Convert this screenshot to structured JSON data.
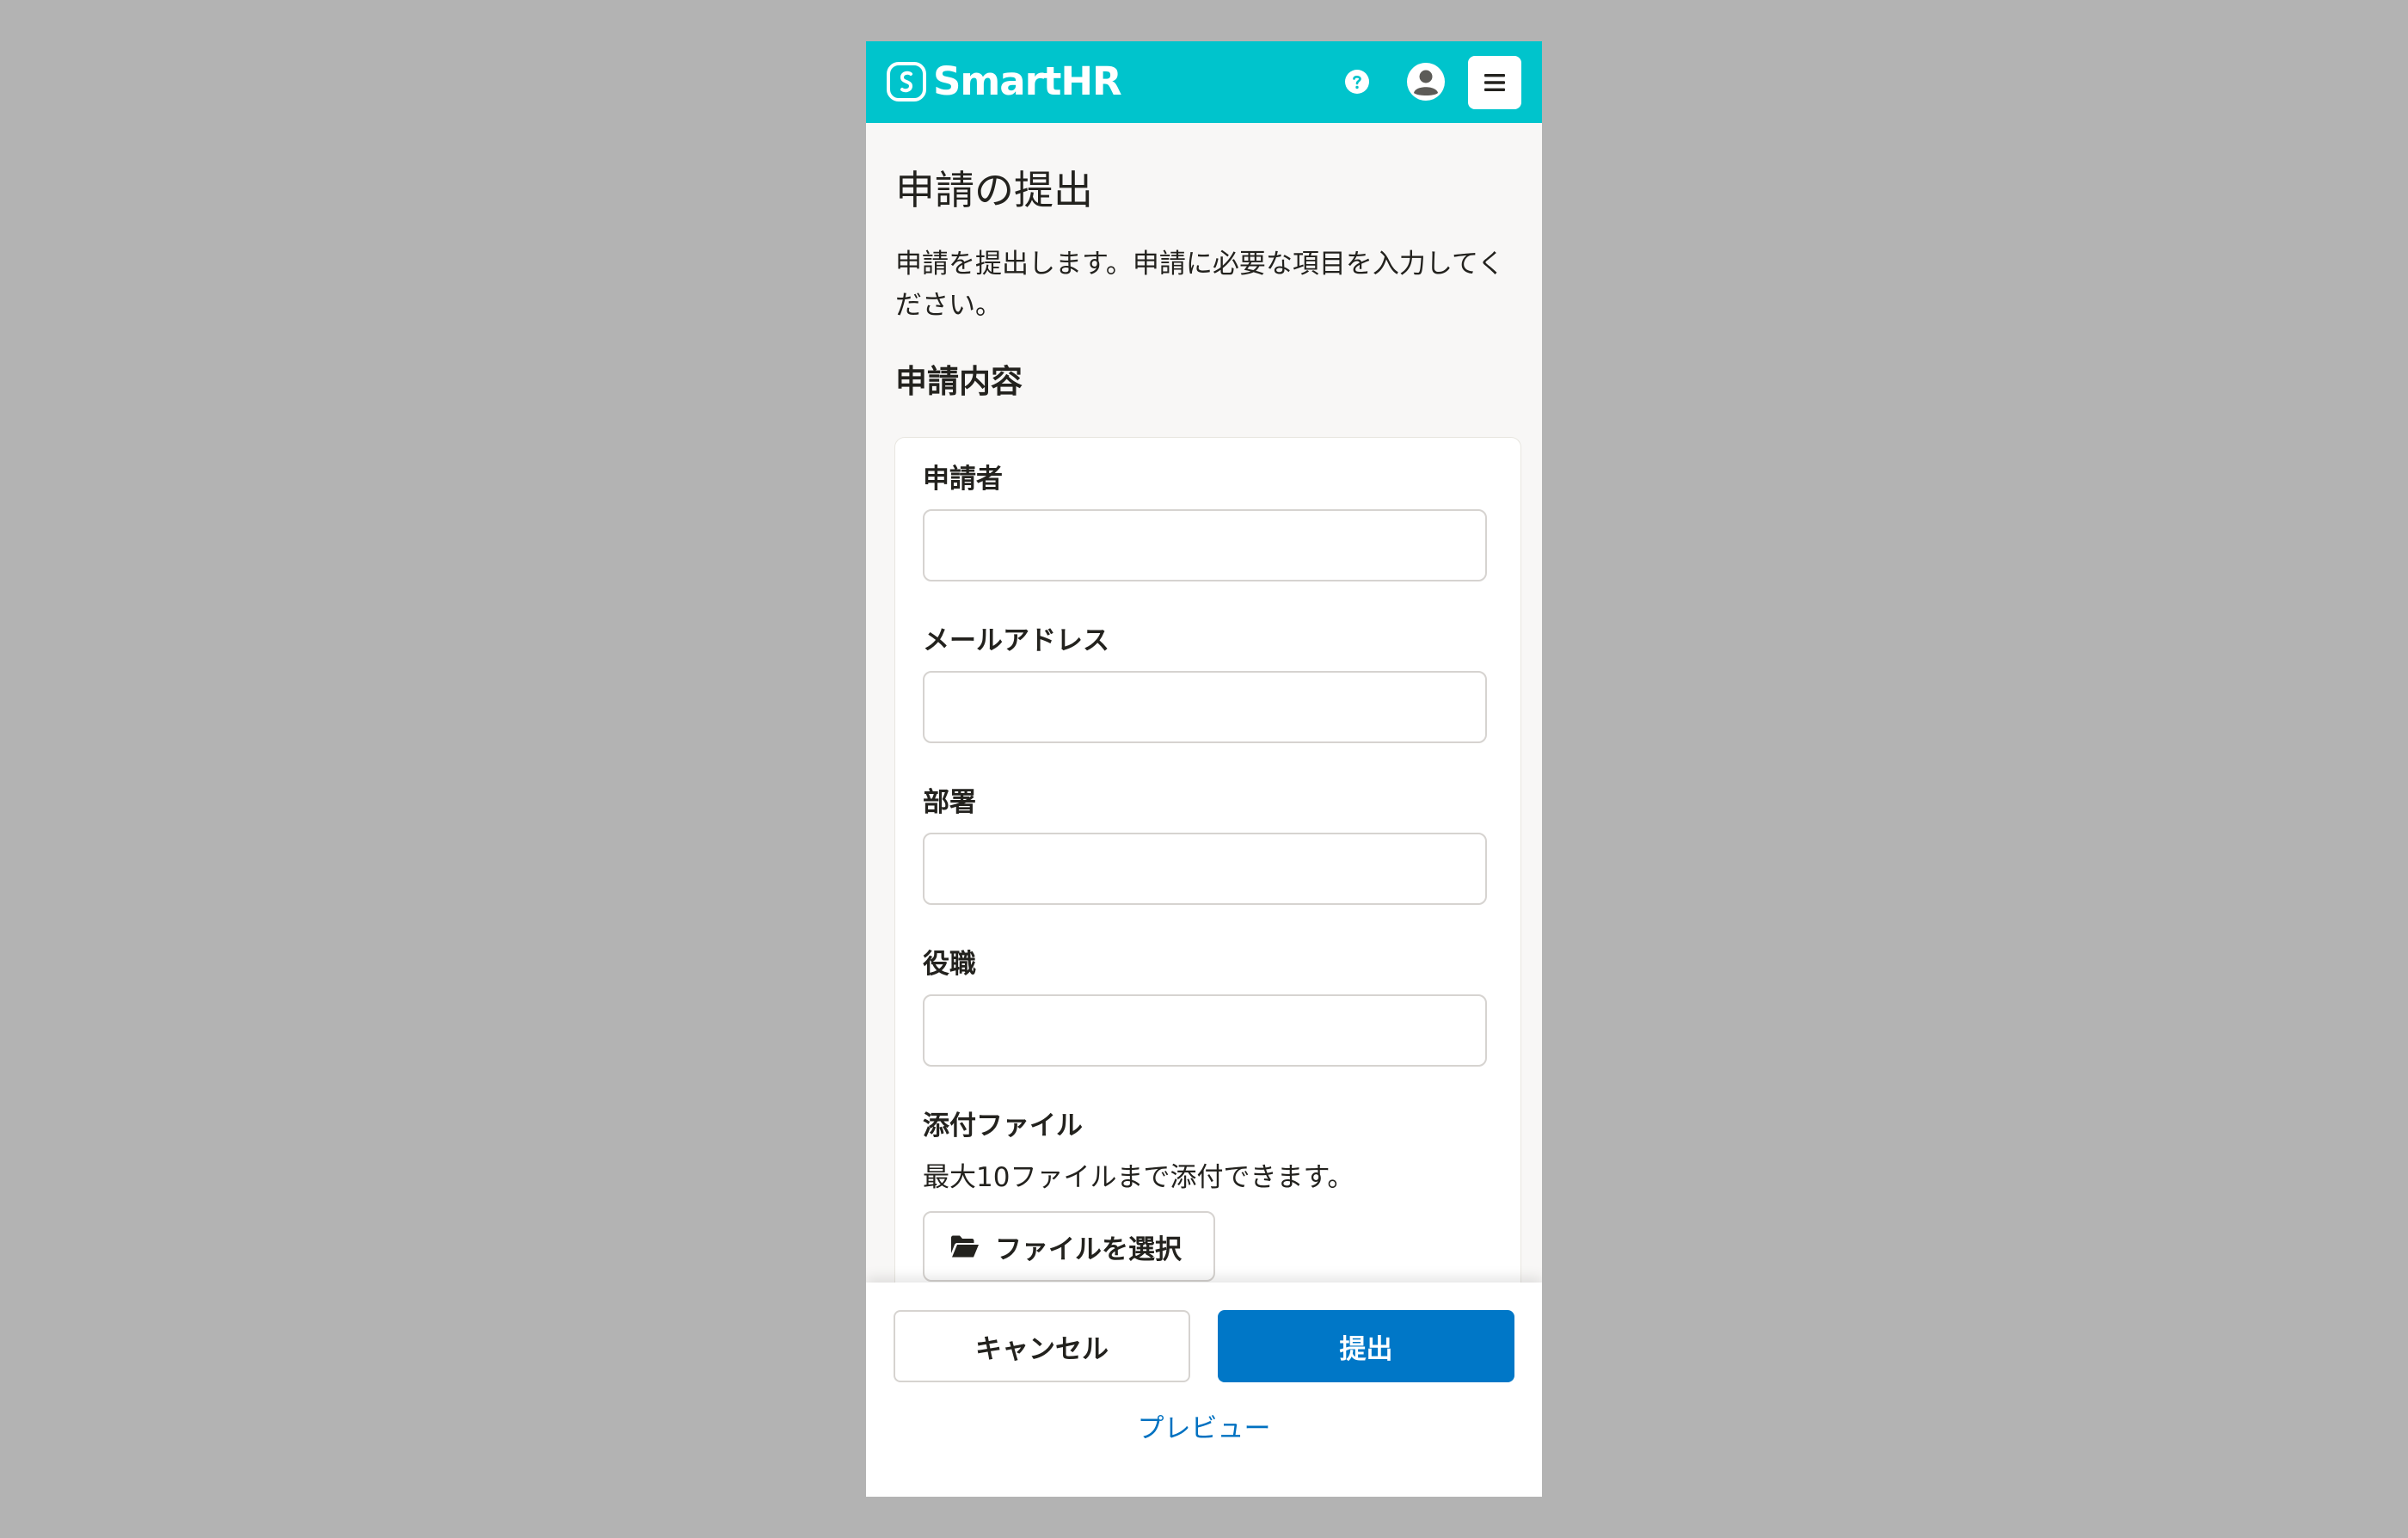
{
  "header": {
    "logo_text": "SmartHR",
    "icons": [
      "smarthr-logo-icon",
      "help-icon",
      "user-account-icon",
      "hamburger-menu-icon"
    ],
    "bg_color": "#00c4cc"
  },
  "page": {
    "title": "申請の提出",
    "description": "申請を提出します。申請に必要な項目を入力してください。",
    "section_title": "申請内容"
  },
  "form": {
    "fields": [
      {
        "label": "申請者",
        "value": ""
      },
      {
        "label": "メールアドレス",
        "value": ""
      },
      {
        "label": "部署",
        "value": ""
      },
      {
        "label": "役職",
        "value": ""
      }
    ],
    "attachment": {
      "label": "添付ファイル",
      "help": "最大10ファイルまで添付できます。",
      "button_label": "ファイルを選択",
      "button_icon": "folder-open-icon"
    }
  },
  "footer": {
    "cancel_label": "キャンセル",
    "submit_label": "提出",
    "preview_label": "プレビュー",
    "submit_color": "#0077c7",
    "link_color": "#0071c1"
  }
}
